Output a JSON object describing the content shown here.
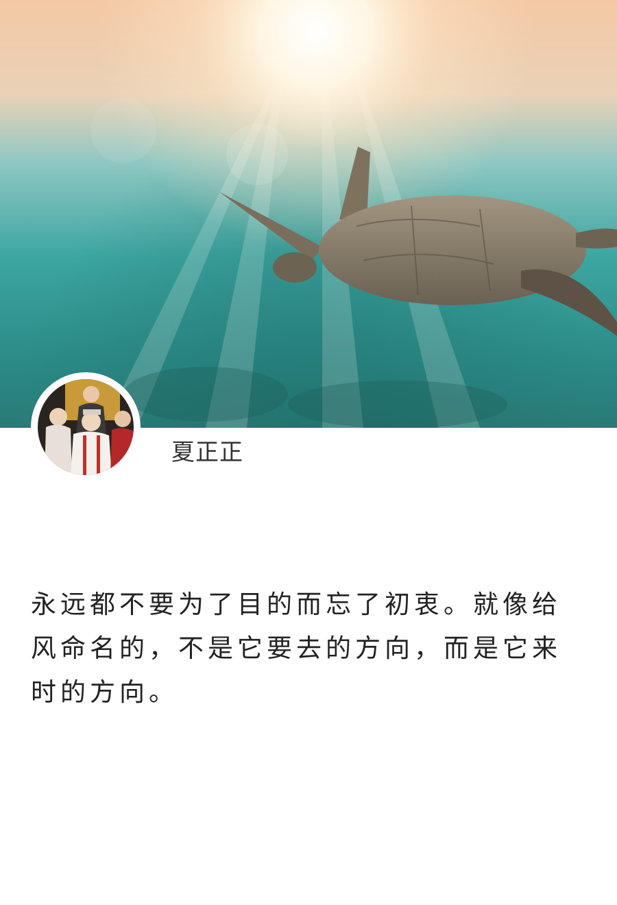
{
  "profile": {
    "username": "夏正正"
  },
  "post": {
    "quote": "永远都不要为了目的而忘了初衷。就像给风命名的，不是它要去的方向，而是它来时的方向。"
  },
  "colors": {
    "background": "#ffffff",
    "text": "#222222",
    "username": "#333333"
  }
}
